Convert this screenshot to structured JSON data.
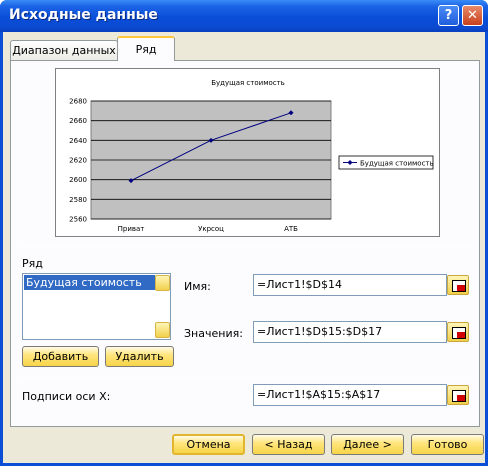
{
  "window": {
    "title": "Исходные данные",
    "help_label": "?",
    "close_label": "✕"
  },
  "tabs": [
    {
      "label": "Диапазон данных",
      "active": false
    },
    {
      "label": "Ряд",
      "active": true
    }
  ],
  "chart_data": {
    "type": "line",
    "title": "Будущая стоимость",
    "categories": [
      "Приват",
      "Укрсоц",
      "АТБ"
    ],
    "series": [
      {
        "name": "Будущая стоимость",
        "values": [
          2599,
          2640,
          2668
        ],
        "color": "#000080"
      }
    ],
    "ylim": [
      2560,
      2680
    ],
    "yticks": [
      "2680",
      "2660",
      "2640",
      "2620",
      "2600",
      "2580",
      "2560"
    ],
    "grid": true,
    "plot_background": "#c0c0c0",
    "legend": "right"
  },
  "series_section": {
    "label": "Ряд",
    "items": [
      "Будущая стоимость"
    ],
    "add_label": "Добавить",
    "remove_label": "Удалить"
  },
  "fields": {
    "name": {
      "label": "Имя:",
      "value": "=Лист1!$D$14"
    },
    "values": {
      "label": "Значения:",
      "value": "=Лист1!$D$15:$D$17"
    },
    "xlabels": {
      "label": "Подписи оси X:",
      "value": "=Лист1!$A$15:$A$17"
    }
  },
  "buttons": {
    "cancel": "Отмена",
    "back": "< Назад",
    "next": "Далее >",
    "finish": "Готово"
  }
}
